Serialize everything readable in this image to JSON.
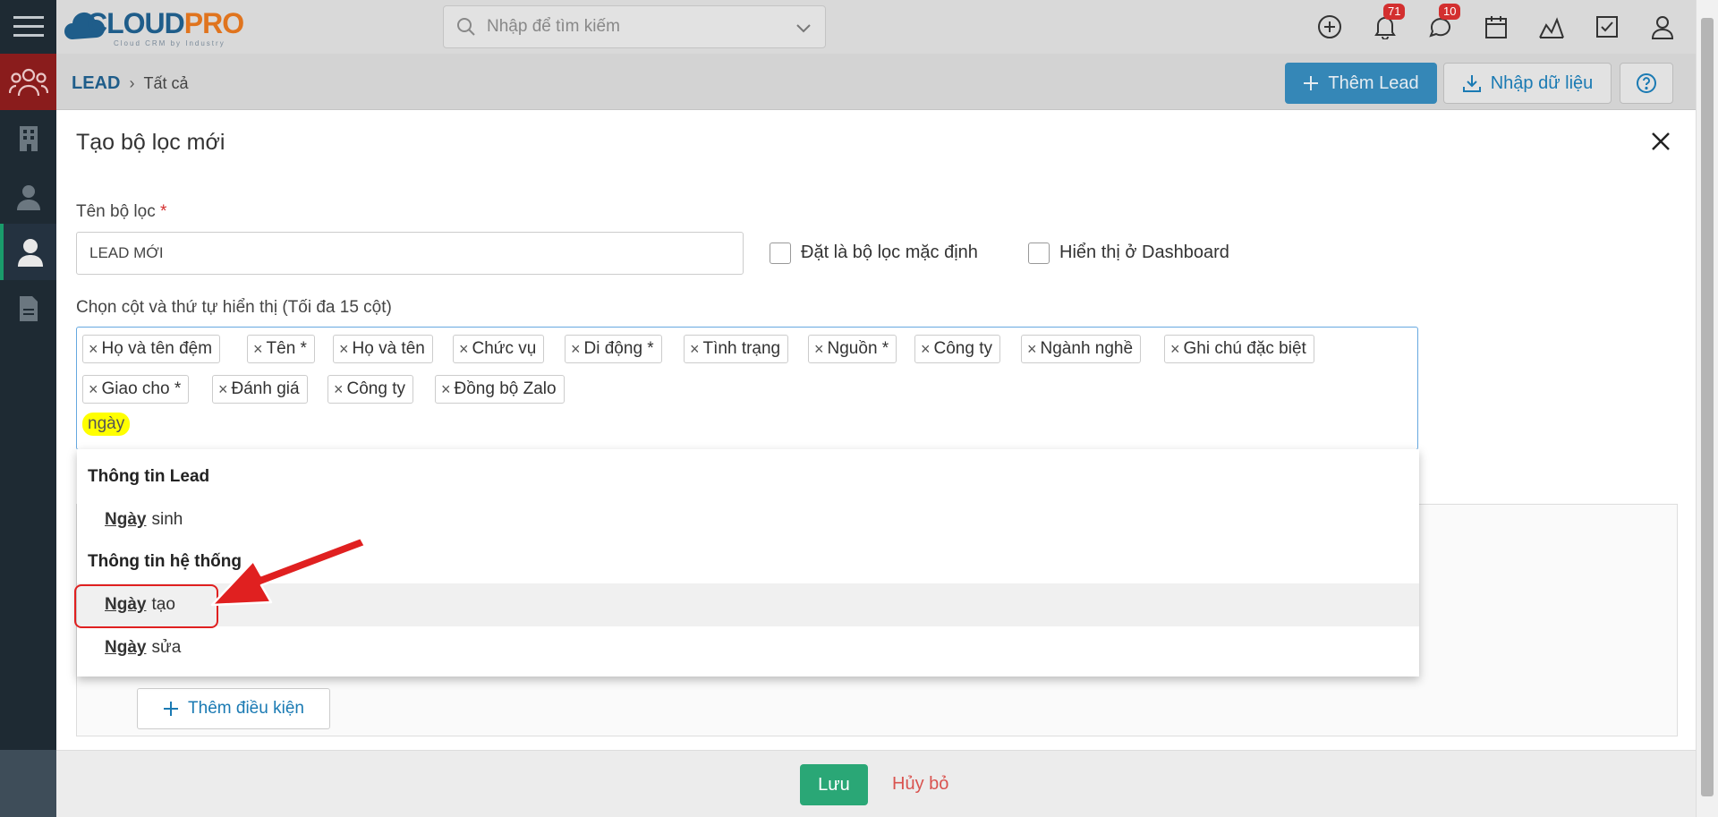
{
  "app": {
    "logo_main": "CLOUD",
    "logo_accent": "PRO",
    "logo_sub": "Cloud CRM by Industry"
  },
  "search": {
    "placeholder": "Nhập để tìm kiếm"
  },
  "badges": {
    "notifications": "71",
    "messages": "10"
  },
  "breadcrumb": {
    "module": "LEAD",
    "view": "Tất cả"
  },
  "header_buttons": {
    "add": "Thêm Lead",
    "import": "Nhập dữ liệu"
  },
  "modal": {
    "title": "Tạo bộ lọc mới",
    "filter_name_label": "Tên bộ lọc",
    "required_mark": "*",
    "filter_name_value": "LEAD MỚI",
    "default_filter_label": "Đặt là bộ lọc mặc định",
    "dashboard_label": "Hiển thị ở Dashboard",
    "columns_label": "Chọn cột và thứ tự hiển thị (Tối đa 15 cột)",
    "tags": [
      "Họ và tên đệm",
      "Tên *",
      "Họ và tên",
      "Chức vụ",
      "Di động *",
      "Tình trạng",
      "Nguồn *",
      "Công ty",
      "Ngành nghề",
      "Ghi chú đặc biệt",
      "Giao cho *",
      "Đánh giá",
      "Công ty",
      "Đồng bộ Zalo"
    ],
    "typed_text": "ngày",
    "add_condition": "Thêm điều kiện"
  },
  "dropdown": {
    "group1": "Thông tin Lead",
    "group2": "Thông tin hệ thống",
    "match": "Ngày",
    "opt1_rest": "sinh",
    "opt2_rest": "tạo",
    "opt3_rest": "sửa"
  },
  "footer": {
    "save": "Lưu",
    "cancel": "Hủy bỏ"
  },
  "colors": {
    "primary": "#1a7ab3",
    "save": "#2aa776",
    "danger": "#d9534f",
    "highlight": "#ffff00"
  }
}
